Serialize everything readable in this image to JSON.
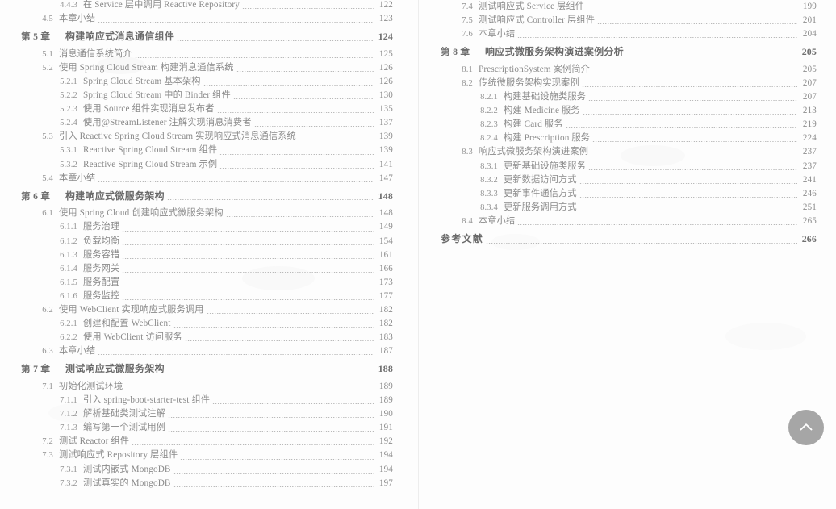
{
  "document": {
    "type": "book-table-of-contents",
    "background_color": "#fdfdfd",
    "text_color": "#8d8d8d",
    "divider_color": "#ededed"
  },
  "left_page": {
    "entries": [
      {
        "level": 3,
        "num": "4.4.3",
        "title": "在 Service 层中调用 Reactive Repository",
        "page": "122"
      },
      {
        "level": 2,
        "num": "4.5",
        "title": "本章小结",
        "page": "123"
      },
      {
        "level": 1,
        "num": "第 5 章",
        "title": "构建响应式消息通信组件",
        "page": "124"
      },
      {
        "level": 2,
        "num": "5.1",
        "title": "消息通信系统简介",
        "page": "125"
      },
      {
        "level": 2,
        "num": "5.2",
        "title": "使用 Spring Cloud Stream 构建消息通信系统",
        "page": "126"
      },
      {
        "level": 3,
        "num": "5.2.1",
        "title": "Spring Cloud Stream 基本架构",
        "page": "126"
      },
      {
        "level": 3,
        "num": "5.2.2",
        "title": "Spring Cloud Stream 中的 Binder 组件",
        "page": "130"
      },
      {
        "level": 3,
        "num": "5.2.3",
        "title": "使用 Source 组件实现消息发布者",
        "page": "135"
      },
      {
        "level": 3,
        "num": "5.2.4",
        "title": "使用@StreamListener 注解实现消息消费者",
        "page": "137"
      },
      {
        "level": 2,
        "num": "5.3",
        "title": "引入 Reactive Spring Cloud Stream 实现响应式消息通信系统",
        "page": "139"
      },
      {
        "level": 3,
        "num": "5.3.1",
        "title": "Reactive Spring Cloud Stream 组件",
        "page": "139"
      },
      {
        "level": 3,
        "num": "5.3.2",
        "title": "Reactive Spring Cloud Stream 示例",
        "page": "141"
      },
      {
        "level": 2,
        "num": "5.4",
        "title": "本章小结",
        "page": "147"
      },
      {
        "level": 1,
        "num": "第 6 章",
        "title": "构建响应式微服务架构",
        "page": "148"
      },
      {
        "level": 2,
        "num": "6.1",
        "title": "使用 Spring Cloud 创建响应式微服务架构",
        "page": "148"
      },
      {
        "level": 3,
        "num": "6.1.1",
        "title": "服务治理",
        "page": "149"
      },
      {
        "level": 3,
        "num": "6.1.2",
        "title": "负载均衡",
        "page": "154"
      },
      {
        "level": 3,
        "num": "6.1.3",
        "title": "服务容错",
        "page": "161"
      },
      {
        "level": 3,
        "num": "6.1.4",
        "title": "服务网关",
        "page": "166"
      },
      {
        "level": 3,
        "num": "6.1.5",
        "title": "服务配置",
        "page": "173"
      },
      {
        "level": 3,
        "num": "6.1.6",
        "title": "服务监控",
        "page": "177"
      },
      {
        "level": 2,
        "num": "6.2",
        "title": "使用 WebClient 实现响应式服务调用",
        "page": "182"
      },
      {
        "level": 3,
        "num": "6.2.1",
        "title": "创建和配置 WebClient",
        "page": "182"
      },
      {
        "level": 3,
        "num": "6.2.2",
        "title": "使用 WebClient 访问服务",
        "page": "183"
      },
      {
        "level": 2,
        "num": "6.3",
        "title": "本章小结",
        "page": "187"
      },
      {
        "level": 1,
        "num": "第 7 章",
        "title": "测试响应式微服务架构",
        "page": "188"
      },
      {
        "level": 2,
        "num": "7.1",
        "title": "初始化测试环境",
        "page": "189"
      },
      {
        "level": 3,
        "num": "7.1.1",
        "title": "引入 spring-boot-starter-test 组件",
        "page": "189"
      },
      {
        "level": 3,
        "num": "7.1.2",
        "title": "解析基础类测试注解",
        "page": "190"
      },
      {
        "level": 3,
        "num": "7.1.3",
        "title": "编写第一个测试用例",
        "page": "191"
      },
      {
        "level": 2,
        "num": "7.2",
        "title": "测试 Reactor 组件",
        "page": "192"
      },
      {
        "level": 2,
        "num": "7.3",
        "title": "测试响应式 Repository 层组件",
        "page": "194"
      },
      {
        "level": 3,
        "num": "7.3.1",
        "title": "测试内嵌式 MongoDB",
        "page": "194"
      },
      {
        "level": 3,
        "num": "7.3.2",
        "title": "测试真实的 MongoDB",
        "page": "197"
      }
    ]
  },
  "right_page": {
    "entries": [
      {
        "level": 2,
        "num": "7.4",
        "title": "测试响应式 Service 层组件",
        "page": "199"
      },
      {
        "level": 2,
        "num": "7.5",
        "title": "测试响应式 Controller 层组件",
        "page": "201"
      },
      {
        "level": 2,
        "num": "7.6",
        "title": "本章小结",
        "page": "204"
      },
      {
        "level": 1,
        "num": "第 8 章",
        "title": "响应式微服务架构演进案例分析",
        "page": "205"
      },
      {
        "level": 2,
        "num": "8.1",
        "title": "PrescriptionSystem 案例简介",
        "page": "205"
      },
      {
        "level": 2,
        "num": "8.2",
        "title": "传统微服务架构实现案例",
        "page": "207"
      },
      {
        "level": 3,
        "num": "8.2.1",
        "title": "构建基础设施类服务",
        "page": "207"
      },
      {
        "level": 3,
        "num": "8.2.2",
        "title": "构建 Medicine 服务",
        "page": "213"
      },
      {
        "level": 3,
        "num": "8.2.3",
        "title": "构建 Card 服务",
        "page": "219"
      },
      {
        "level": 3,
        "num": "8.2.4",
        "title": "构建 Prescription 服务",
        "page": "224"
      },
      {
        "level": 2,
        "num": "8.3",
        "title": "响应式微服务架构演进案例",
        "page": "237"
      },
      {
        "level": 3,
        "num": "8.3.1",
        "title": "更新基础设施类服务",
        "page": "237"
      },
      {
        "level": 3,
        "num": "8.3.2",
        "title": "更新数据访问方式",
        "page": "241"
      },
      {
        "level": 3,
        "num": "8.3.3",
        "title": "更新事件通信方式",
        "page": "246"
      },
      {
        "level": 3,
        "num": "8.3.4",
        "title": "更新服务调用方式",
        "page": "251"
      },
      {
        "level": 2,
        "num": "8.4",
        "title": "本章小结",
        "page": "265"
      },
      {
        "level": 0,
        "num": "",
        "title": "参考文献",
        "page": "266"
      }
    ]
  },
  "controls": {
    "scroll_top_button": {
      "icon": "chevron-up-icon",
      "color": "#a6a6a6",
      "arrow_color": "#ffffff"
    }
  }
}
